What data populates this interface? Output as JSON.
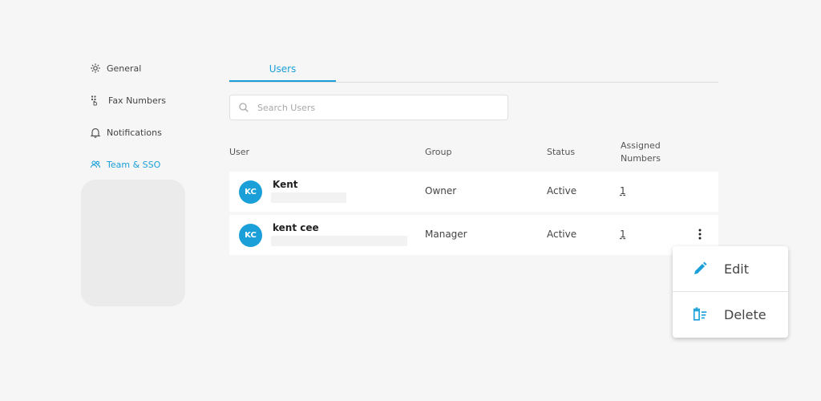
{
  "colors": {
    "accent": "#1a9fd9",
    "background": "#f6f6f6"
  },
  "sidebar": {
    "items": [
      {
        "label": "General",
        "icon": "gear-icon",
        "active": false
      },
      {
        "label": "Fax Numbers",
        "icon": "fax-icon",
        "active": false
      },
      {
        "label": "Notifications",
        "icon": "bell-icon",
        "active": false
      },
      {
        "label": "Team & SSO",
        "icon": "team-icon",
        "active": true
      }
    ]
  },
  "tabs": [
    {
      "label": "Users",
      "active": true
    }
  ],
  "search": {
    "placeholder": "Search Users",
    "value": "",
    "icon": "search-icon"
  },
  "table": {
    "headers": {
      "user": "User",
      "group": "Group",
      "status": "Status",
      "assigned_line1": "Assigned",
      "assigned_line2": "Numbers"
    },
    "rows": [
      {
        "initials": "KC",
        "name": "Kent",
        "group": "Owner",
        "status": "Active",
        "assigned": "1"
      },
      {
        "initials": "KC",
        "name": "kent cee",
        "group": "Manager",
        "status": "Active",
        "assigned": "1"
      }
    ]
  },
  "context_menu": {
    "items": [
      {
        "label": "Edit",
        "icon": "pencil-icon"
      },
      {
        "label": "Delete",
        "icon": "trash-icon"
      }
    ]
  }
}
